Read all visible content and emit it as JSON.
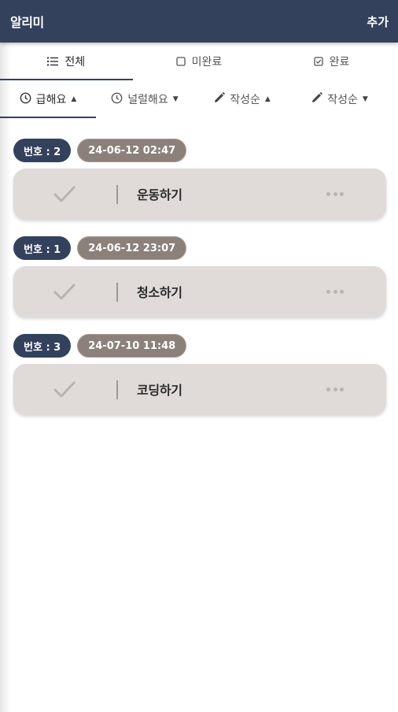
{
  "appbar": {
    "title": "알리미",
    "add_label": "추가"
  },
  "tabs": [
    {
      "label": "전체",
      "icon": "list-icon",
      "active": true
    },
    {
      "label": "미완료",
      "icon": "checkbox-empty-icon",
      "active": false
    },
    {
      "label": "완료",
      "icon": "checkbox-checked-icon",
      "active": false
    }
  ],
  "sorts": [
    {
      "label": "급해요",
      "icon": "clock-icon",
      "caret": "▲",
      "active": true
    },
    {
      "label": "널럴해요",
      "icon": "clock-icon",
      "caret": "▼",
      "active": false
    },
    {
      "label": "작성순",
      "icon": "pencil-icon",
      "caret": "▲",
      "active": false
    },
    {
      "label": "작성순",
      "icon": "pencil-icon",
      "caret": "▼",
      "active": false
    }
  ],
  "todos": [
    {
      "number_label": "번호 : 2",
      "date": "24-06-12 02:47",
      "title": "운동하기"
    },
    {
      "number_label": "번호 : 1",
      "date": "24-06-12 23:07",
      "title": "청소하기"
    },
    {
      "number_label": "번호 : 3",
      "date": "24-07-10 11:48",
      "title": "코딩하기"
    }
  ],
  "colors": {
    "appbar": "#33415c",
    "card": "#e0dbd8",
    "date_badge": "#8c817a",
    "number_badge": "#33415c"
  }
}
